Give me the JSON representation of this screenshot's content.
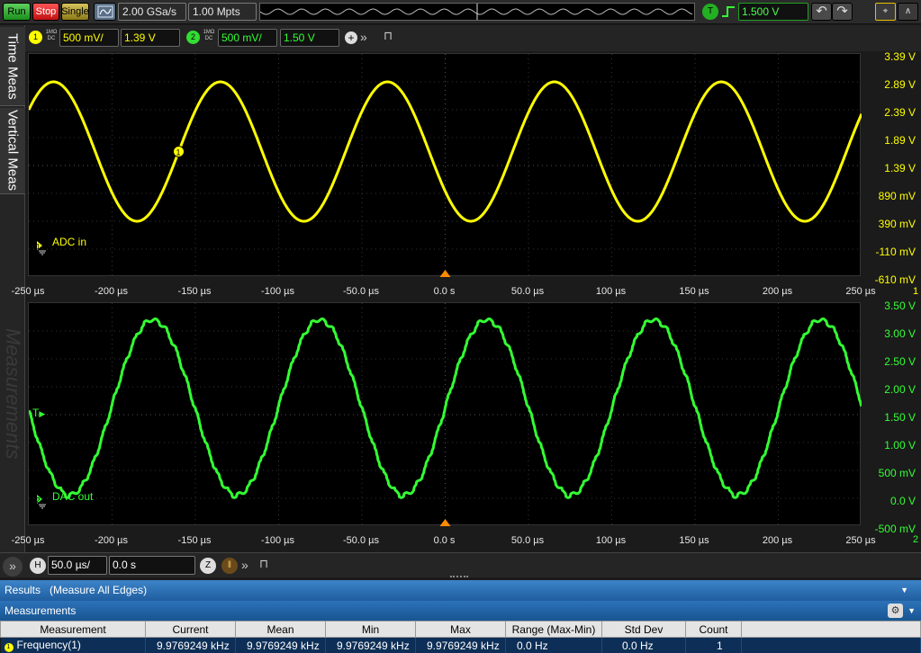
{
  "toolbar": {
    "run_label": "Run",
    "stop_label": "Stop",
    "single_label": "Single",
    "sample_rate": "2.00 GSa/s",
    "memory_depth": "1.00 Mpts",
    "trigger_badge": "T",
    "trigger_level": "1.500 V",
    "trigger_edge_icon": "rising-edge-icon",
    "undo_icon": "undo-icon",
    "redo_icon": "redo-icon"
  },
  "side_tabs": {
    "time_meas": "Time Meas",
    "vertical_meas": "Vertical Meas",
    "measurements_watermark": "Measurements"
  },
  "channels": [
    {
      "number": "1",
      "coupling_top": "1MΩ",
      "coupling_bottom": "DC",
      "scale": "500 mV/",
      "offset": "1.39 V",
      "color": "#ffff00",
      "name": "ADC in"
    },
    {
      "number": "2",
      "coupling_top": "1MΩ",
      "coupling_bottom": "DC",
      "scale": "500 mV/",
      "offset": "1.50 V",
      "color": "#33ff33",
      "name": "DAC out"
    }
  ],
  "plot1": {
    "y_labels": [
      "3.39 V",
      "2.89 V",
      "2.39 V",
      "1.89 V",
      "1.39 V",
      "890 mV",
      "390 mV",
      "-110 mV",
      "-610 mV"
    ],
    "x_labels": [
      "-250 µs",
      "-200 µs",
      "-150 µs",
      "-100 µs",
      "-50.0 µs",
      "0.0 s",
      "50.0 µs",
      "100 µs",
      "150 µs",
      "200 µs",
      "250 µs"
    ],
    "axis_tag": "1"
  },
  "plot2": {
    "y_labels": [
      "3.50 V",
      "3.00 V",
      "2.50 V",
      "2.00 V",
      "1.50 V",
      "1.00 V",
      "500 mV",
      "0.0 V",
      "-500 mV"
    ],
    "x_labels": [
      "-250 µs",
      "-200 µs",
      "-150 µs",
      "-100 µs",
      "-50.0 µs",
      "0.0 s",
      "50.0 µs",
      "100 µs",
      "150 µs",
      "200 µs",
      "250 µs"
    ],
    "axis_tag": "2",
    "trigger_marker": "T"
  },
  "timebase": {
    "h_badge": "H",
    "scale": "50.0 µs/",
    "position": "0.0 s",
    "zoom_badge": "Z"
  },
  "results": {
    "header": "Results   (Measure All Edges)",
    "measurements_title": "Measurements",
    "columns": [
      "Measurement",
      "Current",
      "Mean",
      "Min",
      "Max",
      "Range (Max-Min)",
      "Std Dev",
      "Count"
    ],
    "rows": [
      {
        "measurement": "Frequency(1)",
        "current": "9.9769249 kHz",
        "mean": "9.9769249 kHz",
        "min": "9.9769249 kHz",
        "max": "9.9769249 kHz",
        "range": "0.0 Hz",
        "std_dev": "0.0 Hz",
        "count": "1"
      }
    ]
  },
  "chart_data": [
    {
      "type": "line",
      "xlabel": "",
      "ylabel": "",
      "xlim": [
        -250,
        250
      ],
      "ylim": [
        -0.61,
        3.39
      ],
      "x_unit": "µs",
      "series": [
        {
          "name": "ADC in",
          "waveform": "sine",
          "frequency_hz": 9976.9249,
          "peak_v": 2.89,
          "trough_v": 0.39,
          "offset_v": 1.64,
          "phase_zero_crossing_us": -160,
          "color": "#ffff00"
        }
      ]
    },
    {
      "type": "line",
      "xlabel": "",
      "ylabel": "",
      "xlim": [
        -250,
        250
      ],
      "ylim": [
        -0.5,
        3.5
      ],
      "x_unit": "µs",
      "series": [
        {
          "name": "DAC out",
          "waveform": "stepped sine",
          "frequency_hz": 9976.9249,
          "peak_v": 3.2,
          "trough_v": 0.05,
          "offset_v": 1.625,
          "phase_zero_crossing_us": 0,
          "color": "#33ff33"
        }
      ]
    }
  ]
}
